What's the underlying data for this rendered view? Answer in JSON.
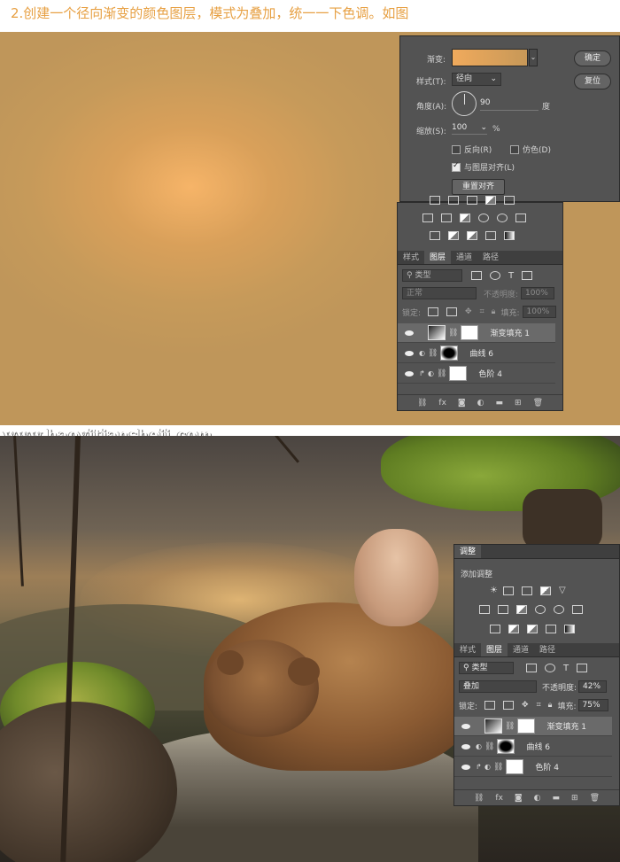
{
  "heading": "2.创建一个径向渐变的颜色图层，模式为叠加，统一一下色调。如图",
  "watermark": "www.haoyitiansheji.com",
  "gradient_dialog": {
    "gradient_label": "渐变:",
    "style_label": "样式(T):",
    "style_value": "径向",
    "angle_label": "角度(A):",
    "angle_value": "90",
    "angle_unit": "度",
    "scale_label": "缩放(S):",
    "scale_value": "100",
    "scale_unit": "%",
    "reverse_label": "反向(R)",
    "dither_label": "仿色(D)",
    "align_label": "与图层对齐(L)",
    "reset_align_label": "重置对齐",
    "ok_label": "确定",
    "reset_label": "复位",
    "reverse_checked": false,
    "dither_checked": false,
    "align_checked": true,
    "gradient_colors": [
      "#f0aa5c",
      "#c79858"
    ]
  },
  "top_panel": {
    "tabs": [
      "样式",
      "图层",
      "通道",
      "路径"
    ],
    "active_tab": "图层",
    "filter_label": "类型",
    "blend_mode": "正常",
    "opacity_label": "不透明度:",
    "opacity_value": "100%",
    "lock_label": "锁定:",
    "fill_label": "填充:",
    "fill_value": "100%",
    "layers": [
      {
        "name": "渐变填充 1",
        "selected": true
      },
      {
        "name": "曲线 6",
        "selected": false
      },
      {
        "name": "色阶 4",
        "selected": false
      }
    ]
  },
  "bottom_panel": {
    "adjust_tab": "调整",
    "add_adjust_label": "添加调整",
    "tabs": [
      "样式",
      "图层",
      "通道",
      "路径"
    ],
    "active_tab": "图层",
    "filter_label": "类型",
    "blend_mode": "叠加",
    "opacity_label": "不透明度:",
    "opacity_value": "42%",
    "lock_label": "锁定:",
    "fill_label": "填充:",
    "fill_value": "75%",
    "layers": [
      {
        "name": "渐变填充 1",
        "selected": true
      },
      {
        "name": "曲线 6",
        "selected": false
      },
      {
        "name": "色阶 4",
        "selected": false
      }
    ]
  }
}
